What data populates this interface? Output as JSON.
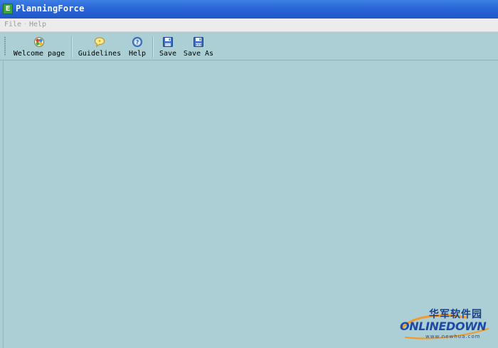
{
  "window": {
    "title": "PlanningForce",
    "app_icon_letter": "E"
  },
  "menubar": {
    "items": [
      {
        "label": "File"
      },
      {
        "label": "Help"
      }
    ],
    "separator": "·"
  },
  "toolbar": {
    "buttons": [
      {
        "label": "Welcome page",
        "icon": "welcome-icon"
      },
      {
        "label": "Guidelines",
        "icon": "speech-bubble-icon"
      },
      {
        "label": "Help",
        "icon": "help-icon"
      },
      {
        "label": "Save",
        "icon": "floppy-disk-icon"
      },
      {
        "label": "Save As",
        "icon": "floppy-disk-save-as-icon"
      }
    ]
  },
  "colors": {
    "title_bar": "#2a66d8",
    "content_background": "#abcfd4",
    "menubar_background": "#ececec"
  },
  "watermark": {
    "chinese_text": "华军软件园",
    "brand": "ONLINEDOWN",
    "url": "www.newhua.com"
  }
}
